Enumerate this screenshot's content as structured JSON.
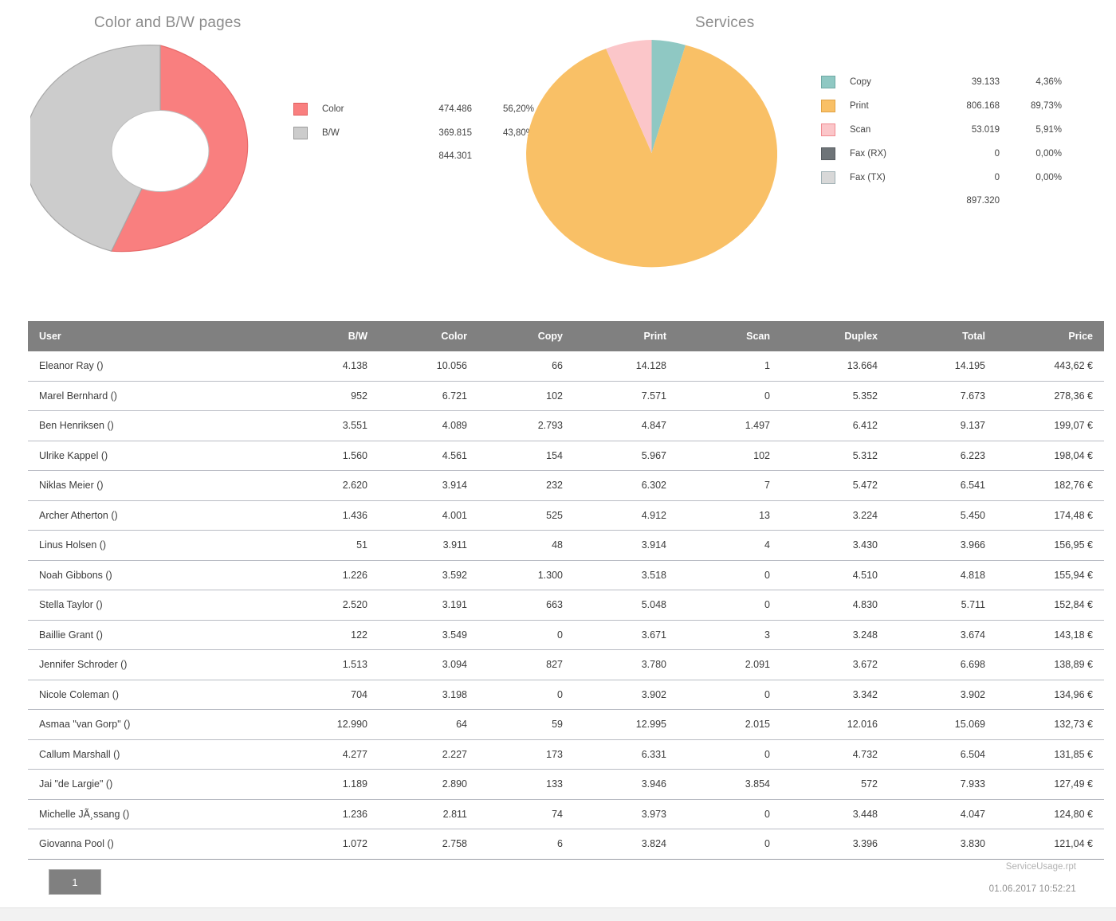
{
  "charts": {
    "donut": {
      "title": "Color and B/W pages",
      "legend": [
        {
          "label": "Color",
          "value": "474.486",
          "percent": "56,20%",
          "color": "#F97F7F"
        },
        {
          "label": "B/W",
          "value": "369.815",
          "percent": "43,80%",
          "color": "#CCCCCC"
        }
      ],
      "total": "844.301"
    },
    "pie": {
      "title": "Services",
      "legend": [
        {
          "label": "Copy",
          "value": "39.133",
          "percent": "4,36%",
          "color": "#8FC8C3"
        },
        {
          "label": "Print",
          "value": "806.168",
          "percent": "89,73%",
          "color": "#F9C066"
        },
        {
          "label": "Scan",
          "value": "53.019",
          "percent": "5,91%",
          "color": "#FBC6C9"
        },
        {
          "label": "Fax (RX)",
          "value": "0",
          "percent": "0,00%",
          "color": "#6E7478"
        },
        {
          "label": "Fax (TX)",
          "value": "0",
          "percent": "0,00%",
          "color": "#D8D8D8"
        }
      ],
      "total": "897.320"
    }
  },
  "chart_data": [
    {
      "type": "pie",
      "title": "Color and B/W pages",
      "variant": "donut",
      "categories": [
        "Color",
        "B/W"
      ],
      "values": [
        474486,
        369815
      ],
      "percents": [
        56.2,
        43.8
      ],
      "colors": [
        "#F97F7F",
        "#CCCCCC"
      ],
      "total": 844301,
      "legend_position": "right",
      "grid": false,
      "xlabel": "",
      "ylabel": ""
    },
    {
      "type": "pie",
      "title": "Services",
      "variant": "pie",
      "categories": [
        "Copy",
        "Print",
        "Scan",
        "Fax (RX)",
        "Fax (TX)"
      ],
      "values": [
        39133,
        806168,
        53019,
        0,
        0
      ],
      "percents": [
        4.36,
        89.73,
        5.91,
        0.0,
        0.0
      ],
      "colors": [
        "#8FC8C3",
        "#F9C066",
        "#FBC6C9",
        "#6E7478",
        "#D8D8D8"
      ],
      "total": 897320,
      "legend_position": "right",
      "grid": false,
      "xlabel": "",
      "ylabel": ""
    }
  ],
  "table": {
    "columns": [
      "User",
      "B/W",
      "Color",
      "Copy",
      "Print",
      "Scan",
      "Duplex",
      "Total",
      "Price"
    ],
    "rows": [
      {
        "user": "Eleanor Ray ()",
        "bw": "4.138",
        "color": "10.056",
        "copy": "66",
        "print": "14.128",
        "scan": "1",
        "duplex": "13.664",
        "total": "14.195",
        "price": "443,62 €"
      },
      {
        "user": "Marel Bernhard ()",
        "bw": "952",
        "color": "6.721",
        "copy": "102",
        "print": "7.571",
        "scan": "0",
        "duplex": "5.352",
        "total": "7.673",
        "price": "278,36 €"
      },
      {
        "user": "Ben Henriksen ()",
        "bw": "3.551",
        "color": "4.089",
        "copy": "2.793",
        "print": "4.847",
        "scan": "1.497",
        "duplex": "6.412",
        "total": "9.137",
        "price": "199,07 €"
      },
      {
        "user": "Ulrike Kappel ()",
        "bw": "1.560",
        "color": "4.561",
        "copy": "154",
        "print": "5.967",
        "scan": "102",
        "duplex": "5.312",
        "total": "6.223",
        "price": "198,04 €"
      },
      {
        "user": "Niklas Meier ()",
        "bw": "2.620",
        "color": "3.914",
        "copy": "232",
        "print": "6.302",
        "scan": "7",
        "duplex": "5.472",
        "total": "6.541",
        "price": "182,76 €"
      },
      {
        "user": "Archer Atherton ()",
        "bw": "1.436",
        "color": "4.001",
        "copy": "525",
        "print": "4.912",
        "scan": "13",
        "duplex": "3.224",
        "total": "5.450",
        "price": "174,48 €"
      },
      {
        "user": "Linus Holsen ()",
        "bw": "51",
        "color": "3.911",
        "copy": "48",
        "print": "3.914",
        "scan": "4",
        "duplex": "3.430",
        "total": "3.966",
        "price": "156,95 €"
      },
      {
        "user": "Noah Gibbons ()",
        "bw": "1.226",
        "color": "3.592",
        "copy": "1.300",
        "print": "3.518",
        "scan": "0",
        "duplex": "4.510",
        "total": "4.818",
        "price": "155,94 €"
      },
      {
        "user": "Stella Taylor ()",
        "bw": "2.520",
        "color": "3.191",
        "copy": "663",
        "print": "5.048",
        "scan": "0",
        "duplex": "4.830",
        "total": "5.711",
        "price": "152,84 €"
      },
      {
        "user": "Baillie Grant ()",
        "bw": "122",
        "color": "3.549",
        "copy": "0",
        "print": "3.671",
        "scan": "3",
        "duplex": "3.248",
        "total": "3.674",
        "price": "143,18 €"
      },
      {
        "user": "Jennifer Schroder ()",
        "bw": "1.513",
        "color": "3.094",
        "copy": "827",
        "print": "3.780",
        "scan": "2.091",
        "duplex": "3.672",
        "total": "6.698",
        "price": "138,89 €"
      },
      {
        "user": "Nicole Coleman ()",
        "bw": "704",
        "color": "3.198",
        "copy": "0",
        "print": "3.902",
        "scan": "0",
        "duplex": "3.342",
        "total": "3.902",
        "price": "134,96 €"
      },
      {
        "user": "Asmaa \"van Gorp\" ()",
        "bw": "12.990",
        "color": "64",
        "copy": "59",
        "print": "12.995",
        "scan": "2.015",
        "duplex": "12.016",
        "total": "15.069",
        "price": "132,73 €"
      },
      {
        "user": "Callum Marshall ()",
        "bw": "4.277",
        "color": "2.227",
        "copy": "173",
        "print": "6.331",
        "scan": "0",
        "duplex": "4.732",
        "total": "6.504",
        "price": "131,85 €"
      },
      {
        "user": "Jai \"de Largie\" ()",
        "bw": "1.189",
        "color": "2.890",
        "copy": "133",
        "print": "3.946",
        "scan": "3.854",
        "duplex": "572",
        "total": "7.933",
        "price": "127,49 €"
      },
      {
        "user": "Michelle JÃ¸ssang ()",
        "bw": "1.236",
        "color": "2.811",
        "copy": "74",
        "print": "3.973",
        "scan": "0",
        "duplex": "3.448",
        "total": "4.047",
        "price": "124,80 €"
      },
      {
        "user": "Giovanna Pool ()",
        "bw": "1.072",
        "color": "2.758",
        "copy": "6",
        "print": "3.824",
        "scan": "0",
        "duplex": "3.396",
        "total": "3.830",
        "price": "121,04 €"
      }
    ]
  },
  "footer": {
    "page_number": "1",
    "report_name": "ServiceUsage.rpt",
    "timestamp": "01.06.2017  10:52:21"
  }
}
